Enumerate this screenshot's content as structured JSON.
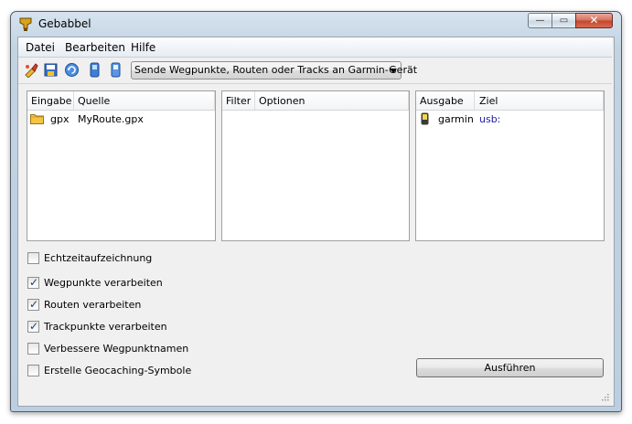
{
  "window": {
    "title": "Gebabbel"
  },
  "menu": {
    "items": [
      "Datei",
      "Bearbeiten",
      "Hilfe"
    ]
  },
  "toolbar": {
    "icons": [
      "clear-icon",
      "save-icon",
      "refresh-icon",
      "import-icon",
      "export-icon"
    ],
    "combo_value": "Sende Wegpunkte, Routen oder Tracks an Garmin-Gerät"
  },
  "input_panel": {
    "headers": [
      "Eingabe",
      "Quelle"
    ],
    "rows": [
      {
        "type": "gpx",
        "source": "MyRoute.gpx"
      }
    ]
  },
  "filter_panel": {
    "headers": [
      "Filter",
      "Optionen"
    ]
  },
  "output_panel": {
    "headers": [
      "Ausgabe",
      "Ziel"
    ],
    "rows": [
      {
        "type": "garmin",
        "target": "usb:"
      }
    ]
  },
  "options": [
    {
      "label": "Echtzeitaufzeichnung",
      "checked": false
    },
    {
      "label": "Wegpunkte verarbeiten",
      "checked": true
    },
    {
      "label": "Routen verarbeiten",
      "checked": true
    },
    {
      "label": "Trackpunkte verarbeiten",
      "checked": true
    },
    {
      "label": "Verbessere Wegpunktnamen",
      "checked": false
    },
    {
      "label": "Erstelle Geocaching-Symbole",
      "checked": false
    }
  ],
  "run_button": "Ausführen",
  "colors": {
    "target_text": "#1a1aa6",
    "accent": "#c3452c"
  }
}
